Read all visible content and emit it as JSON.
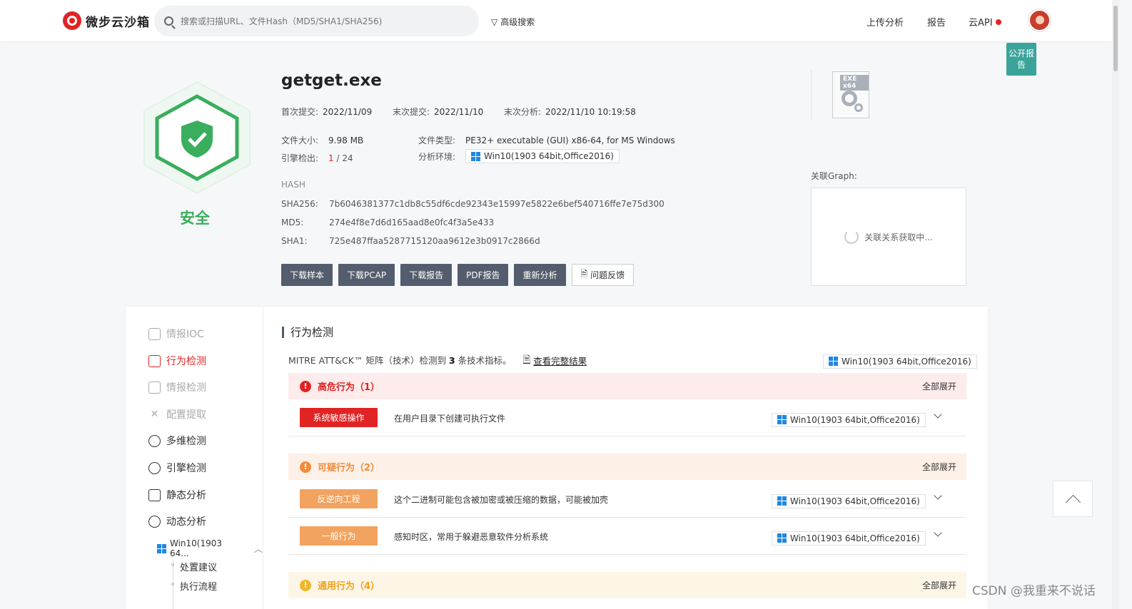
{
  "header": {
    "logo_text": "微步云沙箱",
    "search_placeholder": "搜索或扫描URL、文件Hash（MD5/SHA1/SHA256)",
    "advanced_search": "高级搜索",
    "nav": {
      "upload": "上传分析",
      "report": "报告",
      "api": "云API"
    },
    "public_badge": "公开报告"
  },
  "file": {
    "verdict": "安全",
    "name": "getget.exe",
    "first_submit_label": "首次提交:",
    "first_submit": "2022/11/09",
    "last_submit_label": "末次提交:",
    "last_submit": "2022/11/10",
    "last_analysis_label": "末次分析:",
    "last_analysis": "2022/11/10 10:19:58",
    "size_label": "文件大小:",
    "size": "9.98 MB",
    "type_label": "文件类型:",
    "type": "PE32+ executable (GUI) x86-64, for MS Windows",
    "engine_label": "引擎检出:",
    "engine_hits": "1",
    "engine_total": " / 24",
    "env_label": "分析环境:",
    "env": "Win10(1903 64bit,Office2016)",
    "hash_heading": "HASH",
    "sha256_label": "SHA256:",
    "sha256": "7b6046381377c1db8c55df6cde92343e15997e5822e6bef540716ffe7e75d300",
    "md5_label": "MD5:",
    "md5": "274e4f8e7d6d165aad8e0fc4f3a5e433",
    "sha1_label": "SHA1:",
    "sha1": "725e487ffaa5287715120aa9612e3b0917c2866d",
    "icon_tag": "EXE x64"
  },
  "actions": {
    "download_sample": "下载样本",
    "download_pcap": "下载PCAP",
    "download_report": "下载报告",
    "pdf_report": "PDF报告",
    "reanalyze": "重新分析",
    "feedback": "问题反馈"
  },
  "graph": {
    "label": "关联Graph:",
    "loading": "关联关系获取中..."
  },
  "sidebar": {
    "items": [
      {
        "label": "情报IOC"
      },
      {
        "label": "行为检测"
      },
      {
        "label": "情报检测"
      },
      {
        "label": "配置提取"
      },
      {
        "label": "多维检测"
      },
      {
        "label": "引擎检测"
      },
      {
        "label": "静态分析"
      },
      {
        "label": "动态分析"
      }
    ],
    "env": "Win10(1903 64...",
    "sub_items": [
      "处置建议",
      "执行流程"
    ]
  },
  "behavior": {
    "title": "行为检测",
    "mitre_prefix": "MITRE ATT&CK™ 矩阵（技术）检测到 ",
    "mitre_count": "3",
    "mitre_suffix": " 条技术指标。",
    "full_result": "查看完整结果",
    "env": "Win10(1903 64bit,Office2016)",
    "expand_all": "全部展开",
    "groups": {
      "high": {
        "title": "高危行为（1）"
      },
      "suspicious": {
        "title": "可疑行为（2）"
      },
      "general": {
        "title": "通用行为（4）"
      }
    },
    "rows": [
      {
        "tag": "系统敏感操作",
        "desc": "在用户目录下创建可执行文件",
        "env": "Win10(1903 64bit,Office2016)"
      },
      {
        "tag": "反逆向工程",
        "desc": "这个二进制可能包含被加密或被压缩的数据，可能被加壳",
        "env": "Win10(1903 64bit,Office2016)"
      },
      {
        "tag": "一般行为",
        "desc": "感知时区，常用于躲避恶意软件分析系统",
        "env": "Win10(1903 64bit,Office2016)"
      }
    ]
  },
  "watermark": "CSDN @我重来不说话",
  "colors": {
    "brand_red": "#e02323",
    "safe_green": "#3aae5d",
    "teal": "#3aa39a",
    "orange": "#f08c3a"
  }
}
